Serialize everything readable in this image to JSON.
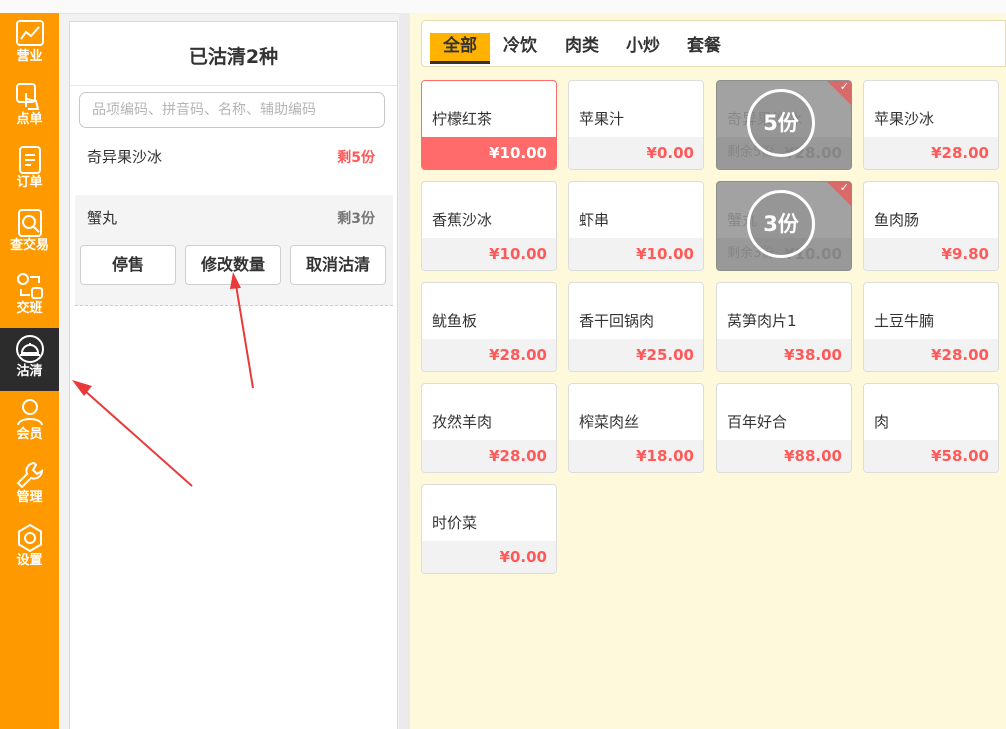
{
  "sidebar": [
    {
      "label": "营业",
      "icon": "chart-icon"
    },
    {
      "label": "点单",
      "icon": "tap-hand-icon"
    },
    {
      "label": "订单",
      "icon": "document-icon"
    },
    {
      "label": "查交易",
      "icon": "search-doc-icon"
    },
    {
      "label": "交班",
      "icon": "shift-exchange-icon"
    },
    {
      "label": "沽清",
      "icon": "cloche-icon"
    },
    {
      "label": "会员",
      "icon": "user-icon"
    },
    {
      "label": "管理",
      "icon": "wrench-icon"
    },
    {
      "label": "设置",
      "icon": "gear-icon"
    }
  ],
  "left_panel": {
    "title": "已沽清2种",
    "search_placeholder": "品项编码、拼音码、名称、辅助编码",
    "items": [
      {
        "name": "奇异果沙冰",
        "remain": "剩5份"
      },
      {
        "name": "蟹丸",
        "remain": "剩3份"
      }
    ],
    "actions": [
      "停售",
      "修改数量",
      "取消沽清"
    ]
  },
  "categories": [
    "全部",
    "冷饮",
    "肉类",
    "小炒",
    "套餐"
  ],
  "dishes": [
    {
      "name": "柠檬红茶",
      "price": "¥10.00"
    },
    {
      "name": "苹果汁",
      "price": "¥0.00"
    },
    {
      "name": "奇异果沙冰",
      "price": "¥28.00",
      "remain_label": "剩余5份",
      "overlay": "5份"
    },
    {
      "name": "苹果沙冰",
      "price": "¥28.00"
    },
    {
      "name": "香蕉沙冰",
      "price": "¥10.00"
    },
    {
      "name": "虾串",
      "price": "¥10.00"
    },
    {
      "name": "蟹丸",
      "price": "¥10.00",
      "remain_label": "剩余3份",
      "overlay": "3份"
    },
    {
      "name": "鱼肉肠",
      "price": "¥9.80"
    },
    {
      "name": "鱿鱼板",
      "price": "¥28.00"
    },
    {
      "name": "香干回锅肉",
      "price": "¥25.00"
    },
    {
      "name": "莴笋肉片1",
      "price": "¥38.00"
    },
    {
      "name": "土豆牛腩",
      "price": "¥28.00"
    },
    {
      "name": "孜然羊肉",
      "price": "¥28.00"
    },
    {
      "name": "榨菜肉丝",
      "price": "¥18.00"
    },
    {
      "name": "百年好合",
      "price": "¥88.00"
    },
    {
      "name": "肉",
      "price": "¥58.00"
    },
    {
      "name": "时价菜",
      "price": "¥0.00"
    }
  ],
  "colors": {
    "brand": "#ff9900",
    "active_nav": "#2c2c2c",
    "price_red": "#ff5a5a",
    "tab_active": "#ffb300",
    "annotation_arrow": "#e83a3a"
  }
}
